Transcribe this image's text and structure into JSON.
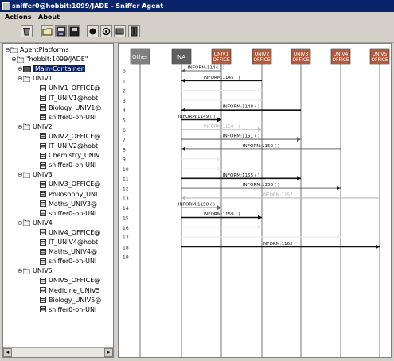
{
  "window": {
    "title": "sniffer0@hobbit:1099/JADE - Sniffer Agent"
  },
  "menu": {
    "items": [
      "Actions",
      "About"
    ]
  },
  "toolbar": {
    "buttons": [
      "clear-canvas-icon",
      "open-file-icon",
      "save-as-icon",
      "save-icon",
      "record-icon",
      "stop-icon",
      "show-only-icon",
      "exit-icon"
    ]
  },
  "tree": {
    "root": "AgentPlatforms",
    "platform": "\"hobbit:1099/JADE\"",
    "main_container": "Main-Container",
    "containers": [
      {
        "name": "UNIV1",
        "agents": [
          "UNIV1_OFFICE@",
          "IT_UNIV1@hobt",
          "Biology_UNIV1@",
          "sniffer0-on-UNI"
        ]
      },
      {
        "name": "UNIV2",
        "agents": [
          "UNIV2_OFFICE@",
          "IT_UNIV2@hobt",
          "Chemistry_UNIV",
          "sniffer0-on-UNI"
        ]
      },
      {
        "name": "UNIV3",
        "agents": [
          "UNIV3_OFFICE@",
          "Philosophy_UNI",
          "Maths_UNIV3@",
          "sniffer0-on-UNI"
        ]
      },
      {
        "name": "UNIV4",
        "agents": [
          "UNIV4_OFFICE@",
          "IT_UNIV4@hobt",
          "Maths_UNIV4@",
          "sniffer0-on-UNI"
        ]
      },
      {
        "name": "UNIV5",
        "agents": [
          "UNIV5_OFFICE@",
          "Medicine_UNIV5",
          "Biology_UNIV5@",
          "sniffer0-on-UNI"
        ]
      }
    ]
  },
  "diagram": {
    "agents": [
      {
        "label": "Other",
        "color": "#808080"
      },
      {
        "label": "NA",
        "color": "#606060"
      },
      {
        "label": "UNIV1\nOFFICE",
        "color": "#b05a40"
      },
      {
        "label": "UNIV2\nOFFICE",
        "color": "#b05a40"
      },
      {
        "label": "UNIV3\nOFFICE",
        "color": "#b05a40"
      },
      {
        "label": "UNIV4\nOFFICE",
        "color": "#b05a40"
      },
      {
        "label": "UNIV5\nOFFICE",
        "color": "#b05a40"
      }
    ],
    "row_numbers": [
      "0",
      "1",
      "2",
      "3",
      "4",
      "5",
      "6",
      "7",
      "8",
      "9",
      "10",
      "11",
      "12",
      "13",
      "14",
      "15",
      "16",
      "17",
      "18",
      "19"
    ],
    "messages": [
      {
        "row": 0,
        "from": 2,
        "to": 1,
        "label": "INFORM:1144 (      )",
        "shade": "gray"
      },
      {
        "row": 1,
        "from": 3,
        "to": 1,
        "label": "INFORM:1145 (      )",
        "shade": "dark"
      },
      {
        "row": 2,
        "from": 1,
        "to": 3,
        "label": "",
        "shade": "faint"
      },
      {
        "row": 3,
        "from": 1,
        "to": 3,
        "label": "",
        "shade": "faint"
      },
      {
        "row": 4,
        "from": 4,
        "to": 1,
        "label": "INFORM:1148 (      )",
        "shade": "dark"
      },
      {
        "row": 5,
        "from": 1,
        "to": 2,
        "label": "INFORM:1149 (      )",
        "shade": "dark"
      },
      {
        "row": 6,
        "from": 1,
        "to": 3,
        "label": "INFORM:1150 (      )",
        "shade": "light"
      },
      {
        "row": 7,
        "from": 1,
        "to": 4,
        "label": "INFORM:1151 (      )",
        "shade": "gray"
      },
      {
        "row": 8,
        "from": 5,
        "to": 1,
        "label": "INFORM:1152 (      )",
        "shade": "dark"
      },
      {
        "row": 9,
        "from": 1,
        "to": 2,
        "label": "",
        "shade": "faint"
      },
      {
        "row": 10,
        "from": 1,
        "to": 2,
        "label": "",
        "shade": "faint"
      },
      {
        "row": 11,
        "from": 1,
        "to": 4,
        "label": "INFORM:1155 (      )",
        "shade": "dark"
      },
      {
        "row": 12,
        "from": 1,
        "to": 5,
        "label": "INFORM:1156 (      )",
        "shade": "dark"
      },
      {
        "row": 13,
        "from": 6,
        "to": 1,
        "label": "INFORM:1157 (      )",
        "shade": "light"
      },
      {
        "row": 14,
        "from": 1,
        "to": 2,
        "label": "INFORM:1158 (      )",
        "shade": "gray"
      },
      {
        "row": 15,
        "from": 1,
        "to": 3,
        "label": "INFORM:1159 (      )",
        "shade": "dark"
      },
      {
        "row": 16,
        "from": 1,
        "to": 3,
        "label": "",
        "shade": "faint"
      },
      {
        "row": 17,
        "from": 1,
        "to": 5,
        "label": "",
        "shade": "faint"
      },
      {
        "row": 18,
        "from": 1,
        "to": 6,
        "label": "INFORM:1162 (      )",
        "shade": "dark"
      }
    ]
  }
}
